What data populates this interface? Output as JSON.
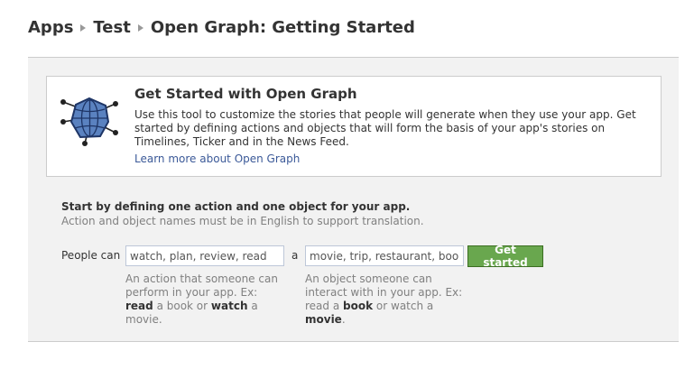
{
  "breadcrumb": {
    "items": [
      "Apps",
      "Test",
      "Open Graph: Getting Started"
    ]
  },
  "intro": {
    "icon": "open-graph-globe-icon",
    "title": "Get Started with Open Graph",
    "description": "Use this tool to customize the stories that people will generate when they use your app. Get started by defining actions and objects that will form the basis of your app's stories on Timelines, Ticker and in the News Feed.",
    "learn_more": "Learn more about Open Graph"
  },
  "instructions": {
    "title": "Start by defining one action and one object for your app.",
    "subtitle": "Action and object names must be in English to support translation."
  },
  "form": {
    "people_can_label": "People can",
    "action_placeholder": "watch, plan, review, read",
    "connector": "a",
    "object_placeholder": "movie, trip, restaurant, book",
    "submit_label": "Get started",
    "action_help": {
      "line1": "An action that someone can perform in your app. Ex:",
      "example_action_1": "read",
      "mid": "a book or",
      "example_action_2": "watch",
      "tail": "a movie."
    },
    "object_help": {
      "line1": "An object someone can interact with in your app. Ex: read a",
      "example_object_1": "book",
      "mid": "or watch a",
      "example_object_2": "movie",
      "tail": "."
    }
  },
  "colors": {
    "link": "#3b5998",
    "button": "#69a74e",
    "panel": "#f2f2f2",
    "icon_fill": "#5a82c0"
  }
}
